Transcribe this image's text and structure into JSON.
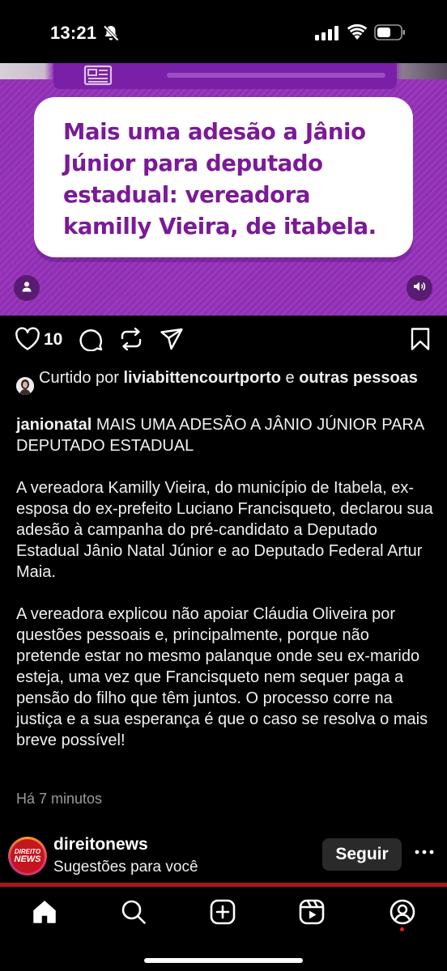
{
  "status_bar": {
    "time": "13:21"
  },
  "post": {
    "headline": "Mais uma adesão a Jânio Júnior para deputado estadual: vereadora kamilly Vieira, de itabela.",
    "like_count": "10",
    "liked_by_prefix": "Curtido por ",
    "liked_by_user": "liviabittencourtporto",
    "liked_by_connector": " e ",
    "liked_by_others": "outras pessoas",
    "author": "janionatal",
    "caption_title": " MAIS UMA ADESÃO A JÂNIO JÚNIOR PARA DEPUTADO ESTADUAL",
    "paragraph_1": "A vereadora Kamilly Vieira, do município de Itabela, ex-esposa do ex-prefeito Luciano Francisqueto, declarou sua adesão à campanha do pré-candidato a Deputado Estadual Jânio Natal Júnior e ao Deputado Federal Artur Maia.",
    "paragraph_2": "A vereadora explicou não apoiar Cláudia Oliveira por questões pessoais e, principalmente, porque não pretende estar no mesmo palanque onde seu ex-marido esteja, uma vez que Francisqueto nem sequer paga a pensão do filho que têm juntos. O processo corre na justiça e a sua esperança é que o caso se resolva o mais breve possível!",
    "timestamp": "Há 7 minutos"
  },
  "suggestion": {
    "avatar_line_1": "DIREITO",
    "avatar_line_2": "NEWS",
    "username": "direitonews",
    "subtitle": "Sugestões para você",
    "follow_label": "Seguir"
  },
  "colors": {
    "image_purple": "#9a38be",
    "headline_purple": "#7a1a96",
    "brand_red": "#c4161c"
  },
  "icons": {
    "tab_bar": [
      "home-icon",
      "search-icon",
      "create-icon",
      "reels-icon",
      "profile-icon"
    ],
    "actions": [
      "heart-icon",
      "comment-icon",
      "repost-icon",
      "share-icon",
      "bookmark-icon"
    ]
  }
}
